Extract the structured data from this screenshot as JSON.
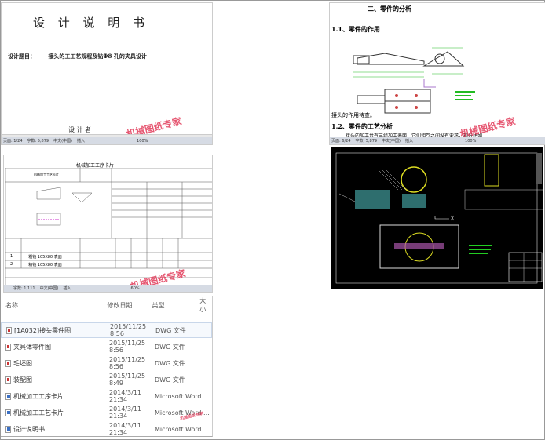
{
  "doc1": {
    "title": "设 计 说 明 书",
    "topic_label": "设计题目：",
    "topic": "接头的工工艺规程及钻Φ8 孔的夹具设计",
    "author_partial": "设 计 者",
    "status": [
      "页面: 1/24",
      "字数: 5,879",
      "中文(中国)",
      "插入",
      "100%"
    ]
  },
  "doc2": {
    "heading": "二、零件的分析",
    "sec1": "1.1、零件的作用",
    "sec1_text": "接头的作用待查。",
    "sec2": "1.2、零件的工艺分析",
    "sec2_text": "接头的加工共有三组加工表面，它们相互之间没有要求，现分述如",
    "status": [
      "页面: 6/24",
      "字数: 5,879",
      "中文(中国)",
      "插入",
      "100%"
    ]
  },
  "card": {
    "title": "机械加工工序卡片",
    "header_left": "机械加工工艺卡片",
    "rows": [
      {
        "no": "1",
        "content": "粗铣 105X80 表面"
      },
      {
        "no": "2",
        "content": "精铣 105X80 表面"
      }
    ],
    "status": [
      "字数: 1,111",
      "中文(中国)",
      "插入",
      "60%"
    ]
  },
  "watermark": "机械图纸专家",
  "explorer": {
    "columns": [
      "名称",
      "修改日期",
      "类型",
      "大小"
    ],
    "files": [
      {
        "name": "[1A032]接头零件图",
        "date": "2015/11/25 8:56",
        "type": "DWG 文件",
        "icon": "dwg"
      },
      {
        "name": "夹具体零件图",
        "date": "2015/11/25 8:56",
        "type": "DWG 文件",
        "icon": "dwg"
      },
      {
        "name": "毛坯图",
        "date": "2015/11/25 8:56",
        "type": "DWG 文件",
        "icon": "dwg"
      },
      {
        "name": "装配图",
        "date": "2015/11/25 8:49",
        "type": "DWG 文件",
        "icon": "dwg"
      },
      {
        "name": "机械加工工序卡片",
        "date": "2014/3/11 21:34",
        "type": "Microsoft Word ...",
        "icon": "doc"
      },
      {
        "name": "机械加工工艺卡片",
        "date": "2014/3/11 21:34",
        "type": "Microsoft Word ...",
        "icon": "doc"
      },
      {
        "name": "设计说明书",
        "date": "2014/3/11 21:34",
        "type": "Microsoft Word ...",
        "icon": "doc"
      }
    ]
  }
}
